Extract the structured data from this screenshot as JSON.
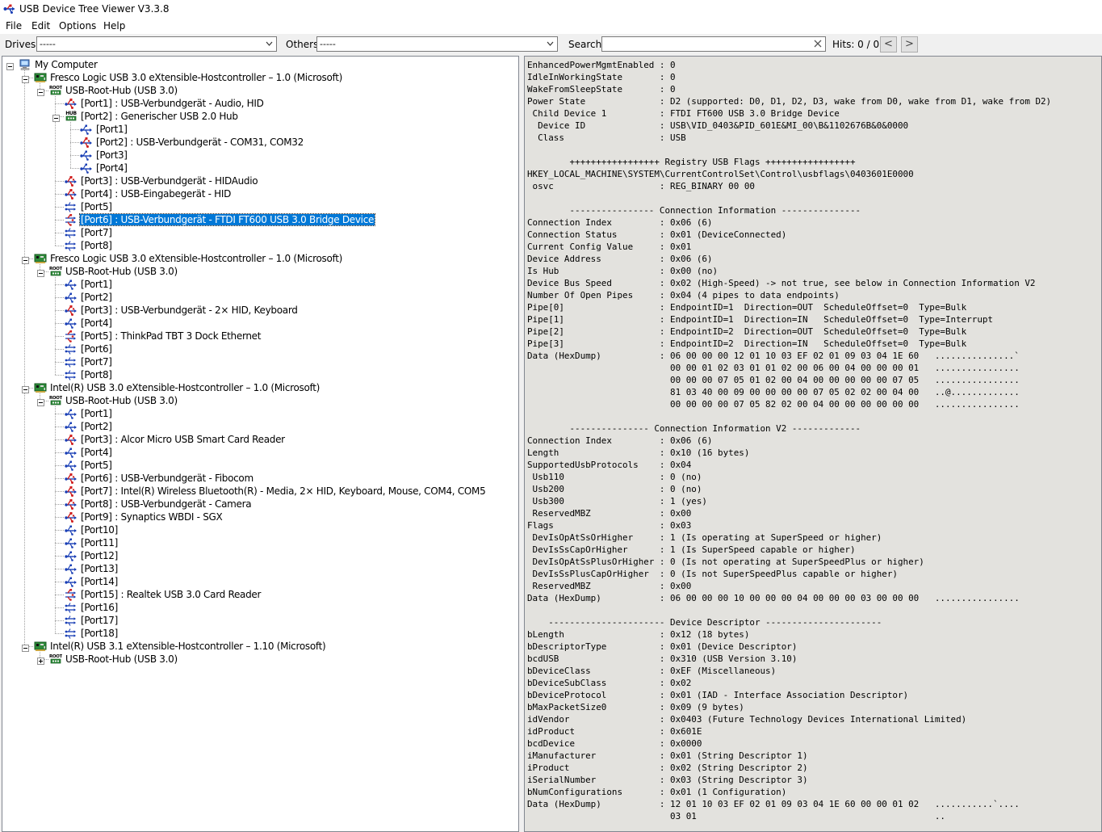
{
  "window": {
    "title": "USB Device Tree Viewer V3.3.8"
  },
  "menu": {
    "items": [
      "File",
      "Edit",
      "Options",
      "Help"
    ]
  },
  "toolbar": {
    "drives_label": "Drives:",
    "drives_value": "-----",
    "others_label": "Others:",
    "others_value": "-----",
    "search_label": "Search:",
    "search_value": "",
    "hits_label": "Hits:  0 / 0",
    "prev_label": "<",
    "next_label": ">"
  },
  "tree": {
    "nodes": [
      {
        "label": "My Computer",
        "icon": "computer-icon",
        "depth": 0,
        "expander": "minus"
      },
      {
        "label": "Fresco Logic USB 3.0 eXtensible-Hostcontroller – 1.0 (Microsoft)",
        "icon": "pci-card-icon",
        "depth": 1,
        "expander": "minus"
      },
      {
        "label": "USB-Root-Hub (USB 3.0)",
        "icon": "root-hub-icon",
        "depth": 2,
        "expander": "minus"
      },
      {
        "label": "[Port1] : USB-Verbundgerät - Audio, HID",
        "icon": "usb-device-icon",
        "depth": 3
      },
      {
        "label": "[Port2] : Generischer USB 2.0 Hub",
        "icon": "hub-icon",
        "depth": 3,
        "expander": "minus"
      },
      {
        "label": "[Port1]",
        "icon": "usb-port-icon",
        "depth": 4
      },
      {
        "label": "[Port2] : USB-Verbundgerät - COM31, COM32",
        "icon": "usb-device-icon",
        "depth": 4
      },
      {
        "label": "[Port3]",
        "icon": "usb-port-icon",
        "depth": 4
      },
      {
        "label": "[Port4]",
        "icon": "usb-port-icon",
        "depth": 4
      },
      {
        "label": "[Port3] : USB-Verbundgerät - HIDAudio",
        "icon": "usb-device-icon",
        "depth": 3
      },
      {
        "label": "[Port4] : USB-Eingabegerät - HID",
        "icon": "usb-device-icon",
        "depth": 3
      },
      {
        "label": "[Port5]",
        "icon": "usb3-port-icon",
        "depth": 3
      },
      {
        "label": "[Port6] : USB-Verbundgerät - FTDI FT600 USB 3.0 Bridge Device",
        "icon": "usb3-device-icon",
        "depth": 3,
        "selected": true
      },
      {
        "label": "[Port7]",
        "icon": "usb3-port-icon",
        "depth": 3
      },
      {
        "label": "[Port8]",
        "icon": "usb3-port-icon",
        "depth": 3
      },
      {
        "label": "Fresco Logic USB 3.0 eXtensible-Hostcontroller – 1.0 (Microsoft)",
        "icon": "pci-card-icon",
        "depth": 1,
        "expander": "minus"
      },
      {
        "label": "USB-Root-Hub (USB 3.0)",
        "icon": "root-hub-icon",
        "depth": 2,
        "expander": "minus"
      },
      {
        "label": "[Port1]",
        "icon": "usb-port-icon",
        "depth": 3
      },
      {
        "label": "[Port2]",
        "icon": "usb-port-icon",
        "depth": 3
      },
      {
        "label": "[Port3] : USB-Verbundgerät - 2× HID, Keyboard",
        "icon": "usb-device-icon",
        "depth": 3
      },
      {
        "label": "[Port4]",
        "icon": "usb-port-icon",
        "depth": 3
      },
      {
        "label": "[Port5] : ThinkPad TBT 3 Dock Ethernet",
        "icon": "usb3-device-icon",
        "depth": 3
      },
      {
        "label": "[Port6]",
        "icon": "usb3-port-icon",
        "depth": 3
      },
      {
        "label": "[Port7]",
        "icon": "usb3-port-icon",
        "depth": 3
      },
      {
        "label": "[Port8]",
        "icon": "usb3-port-icon",
        "depth": 3
      },
      {
        "label": "Intel(R) USB 3.0 eXtensible-Hostcontroller – 1.0 (Microsoft)",
        "icon": "pci-card-icon",
        "depth": 1,
        "expander": "minus"
      },
      {
        "label": "USB-Root-Hub (USB 3.0)",
        "icon": "root-hub-icon",
        "depth": 2,
        "expander": "minus"
      },
      {
        "label": "[Port1]",
        "icon": "usb-port-icon",
        "depth": 3
      },
      {
        "label": "[Port2]",
        "icon": "usb-port-icon",
        "depth": 3
      },
      {
        "label": "[Port3] : Alcor Micro USB Smart Card Reader",
        "icon": "usb-device-icon",
        "depth": 3
      },
      {
        "label": "[Port4]",
        "icon": "usb-port-icon",
        "depth": 3
      },
      {
        "label": "[Port5]",
        "icon": "usb-port-icon",
        "depth": 3
      },
      {
        "label": "[Port6] : USB-Verbundgerät - Fibocom",
        "icon": "usb-device-icon",
        "depth": 3
      },
      {
        "label": "[Port7] : Intel(R) Wireless Bluetooth(R) - Media, 2× HID, Keyboard, Mouse, COM4, COM5",
        "icon": "usb-device-icon",
        "depth": 3
      },
      {
        "label": "[Port8] : USB-Verbundgerät - Camera",
        "icon": "usb-device-icon",
        "depth": 3
      },
      {
        "label": "[Port9] : Synaptics WBDI - SGX",
        "icon": "usb-device-icon",
        "depth": 3
      },
      {
        "label": "[Port10]",
        "icon": "usb-port-icon",
        "depth": 3
      },
      {
        "label": "[Port11]",
        "icon": "usb-port-icon",
        "depth": 3
      },
      {
        "label": "[Port12]",
        "icon": "usb-port-icon",
        "depth": 3
      },
      {
        "label": "[Port13]",
        "icon": "usb-port-icon",
        "depth": 3
      },
      {
        "label": "[Port14]",
        "icon": "usb-port-icon",
        "depth": 3
      },
      {
        "label": "[Port15] : Realtek USB 3.0 Card Reader",
        "icon": "usb3-device-icon",
        "depth": 3
      },
      {
        "label": "[Port16]",
        "icon": "usb3-port-icon",
        "depth": 3
      },
      {
        "label": "[Port17]",
        "icon": "usb3-port-icon",
        "depth": 3
      },
      {
        "label": "[Port18]",
        "icon": "usb3-port-icon",
        "depth": 3
      },
      {
        "label": "Intel(R) USB 3.1 eXtensible-Hostcontroller – 1.10 (Microsoft)",
        "icon": "pci-card-icon",
        "depth": 1,
        "expander": "minus"
      },
      {
        "label": "USB-Root-Hub (USB 3.0)",
        "icon": "root-hub-icon",
        "depth": 2,
        "expander": "plus"
      }
    ]
  },
  "details": {
    "lines": [
      "EnhancedPowerMgmtEnabled : 0",
      "IdleInWorkingState       : 0",
      "WakeFromSleepState       : 0",
      "Power State              : D2 (supported: D0, D1, D2, D3, wake from D0, wake from D1, wake from D2)",
      " Child Device 1          : FTDI FT600 USB 3.0 Bridge Device",
      "  Device ID              : USB\\VID_0403&PID_601E&MI_00\\B&1102676B&0&0000",
      "  Class                  : USB",
      "",
      "        +++++++++++++++++ Registry USB Flags +++++++++++++++++",
      "HKEY_LOCAL_MACHINE\\SYSTEM\\CurrentControlSet\\Control\\usbflags\\0403601E0000",
      " osvc                    : REG_BINARY 00 00",
      "",
      "        ---------------- Connection Information ---------------",
      "Connection Index         : 0x06 (6)",
      "Connection Status        : 0x01 (DeviceConnected)",
      "Current Config Value     : 0x01",
      "Device Address           : 0x06 (6)",
      "Is Hub                   : 0x00 (no)",
      "Device Bus Speed         : 0x02 (High-Speed) -> not true, see below in Connection Information V2",
      "Number Of Open Pipes     : 0x04 (4 pipes to data endpoints)",
      "Pipe[0]                  : EndpointID=1  Direction=OUT  ScheduleOffset=0  Type=Bulk",
      "Pipe[1]                  : EndpointID=1  Direction=IN   ScheduleOffset=0  Type=Interrupt",
      "Pipe[2]                  : EndpointID=2  Direction=OUT  ScheduleOffset=0  Type=Bulk",
      "Pipe[3]                  : EndpointID=2  Direction=IN   ScheduleOffset=0  Type=Bulk",
      "Data (HexDump)           : 06 00 00 00 12 01 10 03 EF 02 01 09 03 04 1E 60   ...............`",
      "                           00 00 01 02 03 01 01 02 00 06 00 04 00 00 00 01   ................",
      "                           00 00 00 07 05 01 02 00 04 00 00 00 00 00 07 05   ................",
      "                           81 03 40 00 09 00 00 00 00 07 05 02 02 00 04 00   ..@.............",
      "                           00 00 00 00 07 05 82 02 00 04 00 00 00 00 00 00   ................",
      "",
      "        --------------- Connection Information V2 -------------",
      "Connection Index         : 0x06 (6)",
      "Length                   : 0x10 (16 bytes)",
      "SupportedUsbProtocols    : 0x04",
      " Usb110                  : 0 (no)",
      " Usb200                  : 0 (no)",
      " Usb300                  : 1 (yes)",
      " ReservedMBZ             : 0x00",
      "Flags                    : 0x03",
      " DevIsOpAtSsOrHigher     : 1 (Is operating at SuperSpeed or higher)",
      " DevIsSsCapOrHigher      : 1 (Is SuperSpeed capable or higher)",
      " DevIsOpAtSsPlusOrHigher : 0 (Is not operating at SuperSpeedPlus or higher)",
      " DevIsSsPlusCapOrHigher  : 0 (Is not SuperSpeedPlus capable or higher)",
      " ReservedMBZ             : 0x00",
      "Data (HexDump)           : 06 00 00 00 10 00 00 00 04 00 00 00 03 00 00 00   ................",
      "",
      "    ---------------------- Device Descriptor ----------------------",
      "bLength                  : 0x12 (18 bytes)",
      "bDescriptorType          : 0x01 (Device Descriptor)",
      "bcdUSB                   : 0x310 (USB Version 3.10)",
      "bDeviceClass             : 0xEF (Miscellaneous)",
      "bDeviceSubClass          : 0x02",
      "bDeviceProtocol          : 0x01 (IAD - Interface Association Descriptor)",
      "bMaxPacketSize0          : 0x09 (9 bytes)",
      "idVendor                 : 0x0403 (Future Technology Devices International Limited)",
      "idProduct                : 0x601E",
      "bcdDevice                : 0x0000",
      "iManufacturer            : 0x01 (String Descriptor 1)",
      "iProduct                 : 0x02 (String Descriptor 2)",
      "iSerialNumber            : 0x03 (String Descriptor 3)",
      "bNumConfigurations       : 0x01 (1 Configuration)",
      "Data (HexDump)           : 12 01 10 03 EF 02 01 09 03 04 1E 60 00 00 01 02   ...........`....",
      "                           03 01                                             .."
    ]
  },
  "colors": {
    "selection": "#0078d7",
    "detail_bg": "#e3e2de",
    "chrome_bg": "#f0f0f0"
  }
}
